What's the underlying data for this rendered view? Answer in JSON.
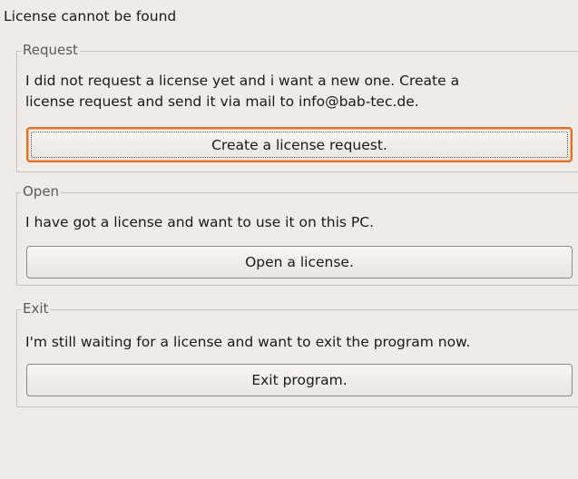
{
  "header": {
    "message": "License cannot be found"
  },
  "groups": {
    "request": {
      "title": "Request",
      "description_line1": "I did not request a license yet and i want a new one. Create a",
      "description_line2": "license request and send it via mail to info@bab-tec.de.",
      "button_label": "Create a license request."
    },
    "open": {
      "title": "Open",
      "description": "I have got a license and want to use it on this PC.",
      "button_label": "Open a license."
    },
    "exit": {
      "title": "Exit",
      "description": "I'm still waiting for a license and want to exit the program now.",
      "button_label": "Exit program."
    }
  },
  "colors": {
    "background": "#efebe7",
    "focus_accent": "#e0702a",
    "group_border": "#c9c3bc"
  }
}
